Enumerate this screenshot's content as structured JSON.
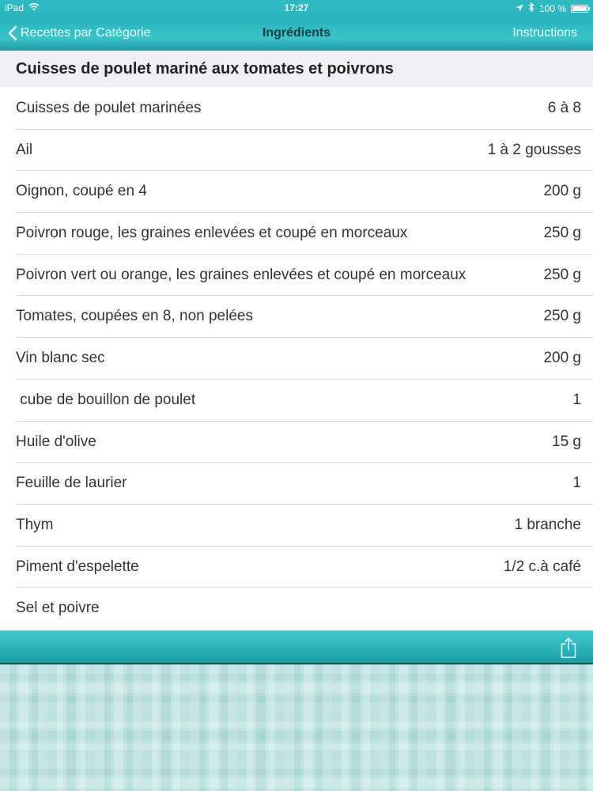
{
  "status_bar": {
    "device": "iPad",
    "time": "17:27",
    "battery_text": "100 %",
    "battery_level": 1.0
  },
  "nav": {
    "back_label": "Recettes par Catégorie",
    "title": "Ingrédients",
    "right_label": "Instructions"
  },
  "recipe": {
    "title": "Cuisses de poulet mariné aux tomates et poivrons"
  },
  "ingredients": [
    {
      "name": "Cuisses de poulet marinées",
      "qty": "6 à 8"
    },
    {
      "name": "Ail",
      "qty": "1 à 2 gousses"
    },
    {
      "name": "Oignon, coupé en 4",
      "qty": "200 g"
    },
    {
      "name": "Poivron rouge, les graines enlevées et coupé en morceaux",
      "qty": "250 g"
    },
    {
      "name": "Poivron vert ou orange, les graines enlevées et coupé en morceaux",
      "qty": "250 g"
    },
    {
      "name": "Tomates, coupées en 8, non pelées",
      "qty": "250 g"
    },
    {
      "name": "Vin blanc sec",
      "qty": "200 g"
    },
    {
      "name": " cube de bouillon de poulet",
      "qty": "1"
    },
    {
      "name": "Huile d'olive",
      "qty": "15 g"
    },
    {
      "name": "Feuille de laurier",
      "qty": "1"
    },
    {
      "name": "Thym",
      "qty": "1 branche"
    },
    {
      "name": "Piment d'espelette",
      "qty": "1/2 c.à café"
    },
    {
      "name": "Sel et poivre",
      "qty": ""
    }
  ],
  "icons": {
    "wifi": "wifi-icon",
    "location": "location-arrow-icon",
    "bluetooth": "bluetooth-icon",
    "battery": "battery-icon",
    "back": "chevron-left-icon",
    "share": "share-icon"
  },
  "colors": {
    "accent": "#2bb6bd",
    "title_band": "#efeff4",
    "separator": "#dcdcdc"
  }
}
